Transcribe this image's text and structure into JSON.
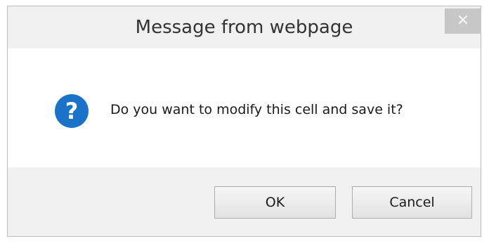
{
  "dialog": {
    "title": "Message from webpage",
    "close_label": "×",
    "icon": "question-icon",
    "message": "Do you want to modify this cell and save it?",
    "buttons": {
      "ok": "OK",
      "cancel": "Cancel"
    }
  },
  "colors": {
    "icon_blue": "#1a73c8",
    "chrome_gray": "#f0f0f0",
    "close_button": "#c7c7c7"
  }
}
